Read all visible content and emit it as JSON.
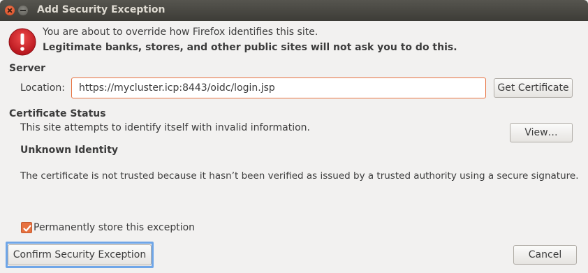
{
  "window": {
    "title": "Add Security Exception"
  },
  "intro": {
    "line1": "You are about to override how Firefox identifies this site.",
    "line2": "Legitimate banks, stores, and other public sites will not ask you to do this."
  },
  "server": {
    "heading": "Server",
    "location_label": "Location:",
    "location_value": "https://mycluster.icp:8443/oidc/login.jsp",
    "get_certificate_label": "Get Certificate"
  },
  "certificate_status": {
    "heading": "Certificate Status",
    "summary": "This site attempts to identify itself with invalid information.",
    "view_label": "View…",
    "unknown_identity_heading": "Unknown Identity",
    "unknown_identity_detail": "The certificate is not trusted because it hasn’t been verified as issued by a trusted authority using a secure signature."
  },
  "permanent_store": {
    "label": "Permanently store this exception",
    "checked": true
  },
  "actions": {
    "confirm_label": "Confirm Security Exception",
    "cancel_label": "Cancel"
  },
  "colors": {
    "accent": "#e7713f",
    "focus_ring": "#6fa6e8",
    "alert_red": "#c7161d"
  }
}
